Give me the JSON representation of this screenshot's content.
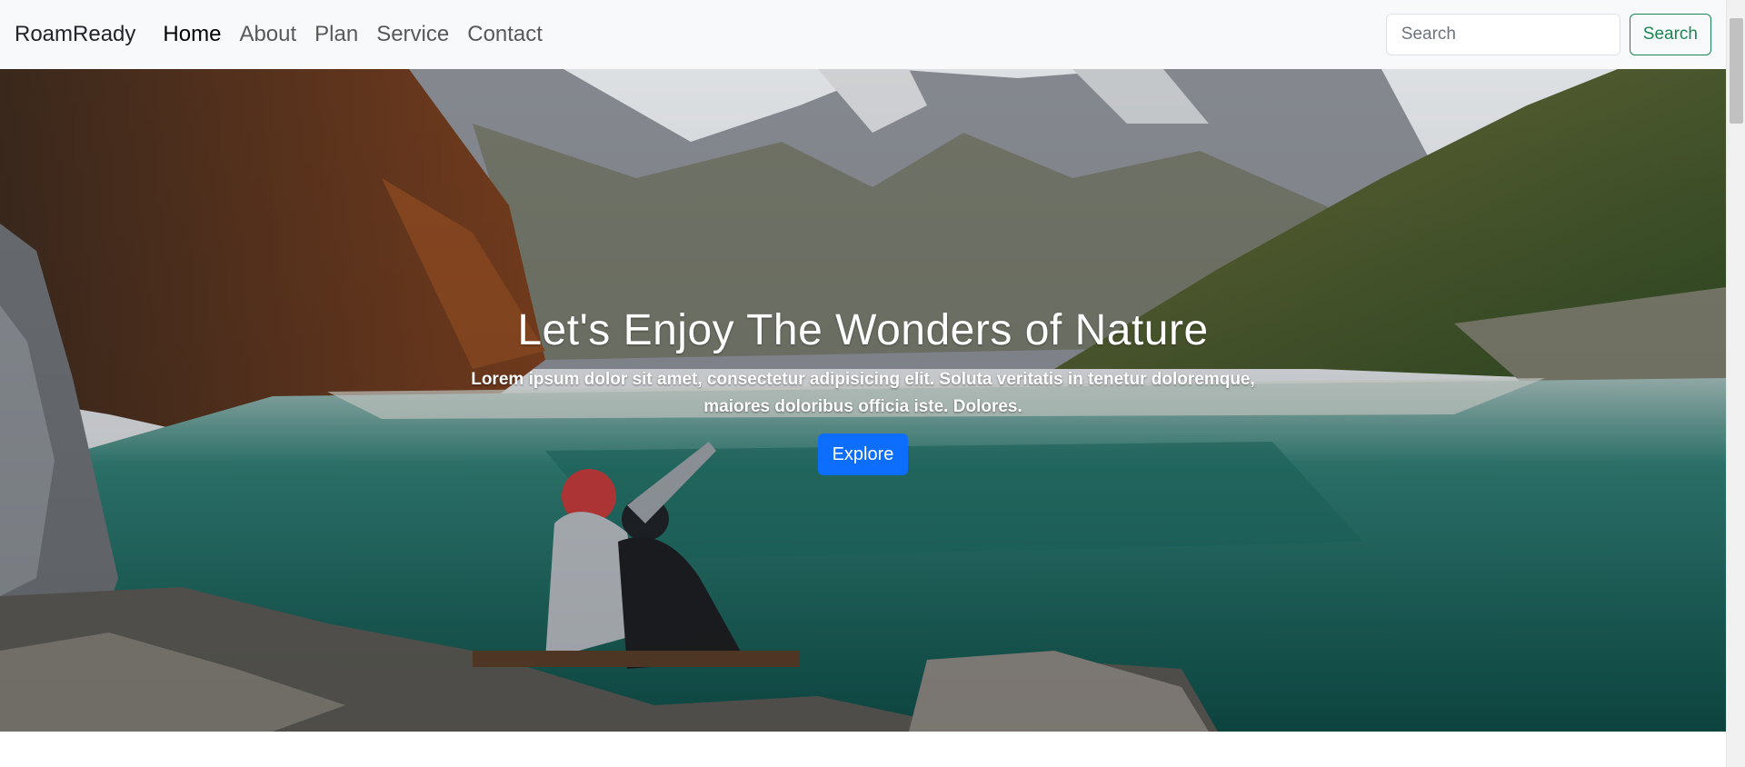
{
  "navbar": {
    "brand": "RoamReady",
    "links": [
      {
        "label": "Home",
        "active": true
      },
      {
        "label": "About",
        "active": false
      },
      {
        "label": "Plan",
        "active": false
      },
      {
        "label": "Service",
        "active": false
      },
      {
        "label": "Contact",
        "active": false
      }
    ],
    "search": {
      "placeholder": "Search",
      "value": "",
      "button_label": "Search"
    }
  },
  "hero": {
    "title": "Let's Enjoy The Wonders of Nature",
    "subtitle": "Lorem ipsum dolor sit amet, consectetur adipisicing elit. Soluta veritatis in tenetur doloremque, maiores doloribus officia iste. Dolores.",
    "button_label": "Explore"
  },
  "colors": {
    "navbar_bg": "#f8f9fa",
    "search_button": "#198754",
    "explore_button": "#0d6efd"
  }
}
